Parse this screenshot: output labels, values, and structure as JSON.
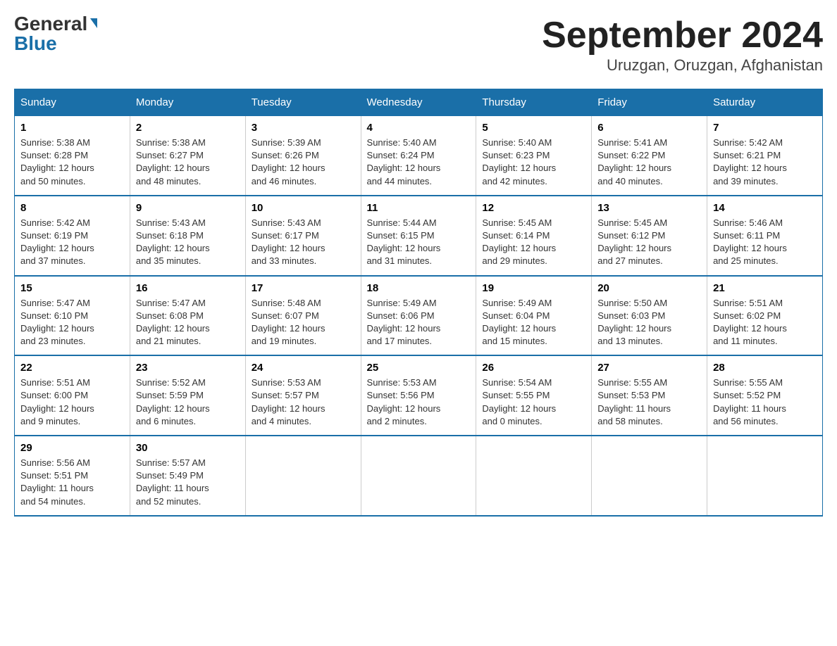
{
  "header": {
    "logo_general": "General",
    "logo_blue": "Blue",
    "month_title": "September 2024",
    "location": "Uruzgan, Oruzgan, Afghanistan"
  },
  "weekdays": [
    "Sunday",
    "Monday",
    "Tuesday",
    "Wednesday",
    "Thursday",
    "Friday",
    "Saturday"
  ],
  "weeks": [
    [
      {
        "day": "1",
        "sunrise": "5:38 AM",
        "sunset": "6:28 PM",
        "daylight": "12 hours and 50 minutes."
      },
      {
        "day": "2",
        "sunrise": "5:38 AM",
        "sunset": "6:27 PM",
        "daylight": "12 hours and 48 minutes."
      },
      {
        "day": "3",
        "sunrise": "5:39 AM",
        "sunset": "6:26 PM",
        "daylight": "12 hours and 46 minutes."
      },
      {
        "day": "4",
        "sunrise": "5:40 AM",
        "sunset": "6:24 PM",
        "daylight": "12 hours and 44 minutes."
      },
      {
        "day": "5",
        "sunrise": "5:40 AM",
        "sunset": "6:23 PM",
        "daylight": "12 hours and 42 minutes."
      },
      {
        "day": "6",
        "sunrise": "5:41 AM",
        "sunset": "6:22 PM",
        "daylight": "12 hours and 40 minutes."
      },
      {
        "day": "7",
        "sunrise": "5:42 AM",
        "sunset": "6:21 PM",
        "daylight": "12 hours and 39 minutes."
      }
    ],
    [
      {
        "day": "8",
        "sunrise": "5:42 AM",
        "sunset": "6:19 PM",
        "daylight": "12 hours and 37 minutes."
      },
      {
        "day": "9",
        "sunrise": "5:43 AM",
        "sunset": "6:18 PM",
        "daylight": "12 hours and 35 minutes."
      },
      {
        "day": "10",
        "sunrise": "5:43 AM",
        "sunset": "6:17 PM",
        "daylight": "12 hours and 33 minutes."
      },
      {
        "day": "11",
        "sunrise": "5:44 AM",
        "sunset": "6:15 PM",
        "daylight": "12 hours and 31 minutes."
      },
      {
        "day": "12",
        "sunrise": "5:45 AM",
        "sunset": "6:14 PM",
        "daylight": "12 hours and 29 minutes."
      },
      {
        "day": "13",
        "sunrise": "5:45 AM",
        "sunset": "6:12 PM",
        "daylight": "12 hours and 27 minutes."
      },
      {
        "day": "14",
        "sunrise": "5:46 AM",
        "sunset": "6:11 PM",
        "daylight": "12 hours and 25 minutes."
      }
    ],
    [
      {
        "day": "15",
        "sunrise": "5:47 AM",
        "sunset": "6:10 PM",
        "daylight": "12 hours and 23 minutes."
      },
      {
        "day": "16",
        "sunrise": "5:47 AM",
        "sunset": "6:08 PM",
        "daylight": "12 hours and 21 minutes."
      },
      {
        "day": "17",
        "sunrise": "5:48 AM",
        "sunset": "6:07 PM",
        "daylight": "12 hours and 19 minutes."
      },
      {
        "day": "18",
        "sunrise": "5:49 AM",
        "sunset": "6:06 PM",
        "daylight": "12 hours and 17 minutes."
      },
      {
        "day": "19",
        "sunrise": "5:49 AM",
        "sunset": "6:04 PM",
        "daylight": "12 hours and 15 minutes."
      },
      {
        "day": "20",
        "sunrise": "5:50 AM",
        "sunset": "6:03 PM",
        "daylight": "12 hours and 13 minutes."
      },
      {
        "day": "21",
        "sunrise": "5:51 AM",
        "sunset": "6:02 PM",
        "daylight": "12 hours and 11 minutes."
      }
    ],
    [
      {
        "day": "22",
        "sunrise": "5:51 AM",
        "sunset": "6:00 PM",
        "daylight": "12 hours and 9 minutes."
      },
      {
        "day": "23",
        "sunrise": "5:52 AM",
        "sunset": "5:59 PM",
        "daylight": "12 hours and 6 minutes."
      },
      {
        "day": "24",
        "sunrise": "5:53 AM",
        "sunset": "5:57 PM",
        "daylight": "12 hours and 4 minutes."
      },
      {
        "day": "25",
        "sunrise": "5:53 AM",
        "sunset": "5:56 PM",
        "daylight": "12 hours and 2 minutes."
      },
      {
        "day": "26",
        "sunrise": "5:54 AM",
        "sunset": "5:55 PM",
        "daylight": "12 hours and 0 minutes."
      },
      {
        "day": "27",
        "sunrise": "5:55 AM",
        "sunset": "5:53 PM",
        "daylight": "11 hours and 58 minutes."
      },
      {
        "day": "28",
        "sunrise": "5:55 AM",
        "sunset": "5:52 PM",
        "daylight": "11 hours and 56 minutes."
      }
    ],
    [
      {
        "day": "29",
        "sunrise": "5:56 AM",
        "sunset": "5:51 PM",
        "daylight": "11 hours and 54 minutes."
      },
      {
        "day": "30",
        "sunrise": "5:57 AM",
        "sunset": "5:49 PM",
        "daylight": "11 hours and 52 minutes."
      },
      null,
      null,
      null,
      null,
      null
    ]
  ],
  "labels": {
    "sunrise": "Sunrise:",
    "sunset": "Sunset:",
    "daylight": "Daylight:"
  }
}
